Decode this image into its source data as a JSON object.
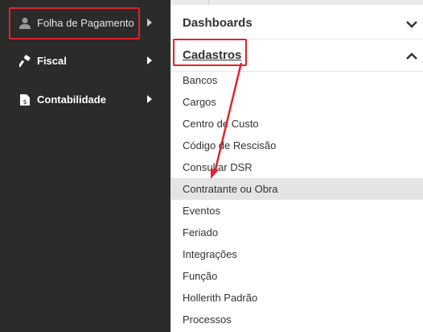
{
  "sidebar": {
    "items": [
      {
        "label": "Folha de Pagamento",
        "icon": "user-icon"
      },
      {
        "label": "Fiscal",
        "icon": "hammer-icon"
      },
      {
        "label": "Contabilidade",
        "icon": "document-dollar-icon"
      }
    ]
  },
  "menu": {
    "sections": [
      {
        "title": "Dashboards",
        "state": "collapsed"
      },
      {
        "title": "Cadastros",
        "state": "expanded"
      }
    ],
    "items": [
      "Bancos",
      "Cargos",
      "Centro de Custo",
      "Código de Rescisão",
      "Consultar DSR",
      "Contratante ou Obra",
      "Eventos",
      "Feriado",
      "Integrações",
      "Função",
      "Hollerith Padrão",
      "Processos"
    ],
    "hovered_item": "Contratante ou Obra"
  },
  "colors": {
    "sidebar_bg": "#2b2b2b",
    "annotation_red": "#e3232a",
    "hover_bg": "#e4e4e4"
  }
}
